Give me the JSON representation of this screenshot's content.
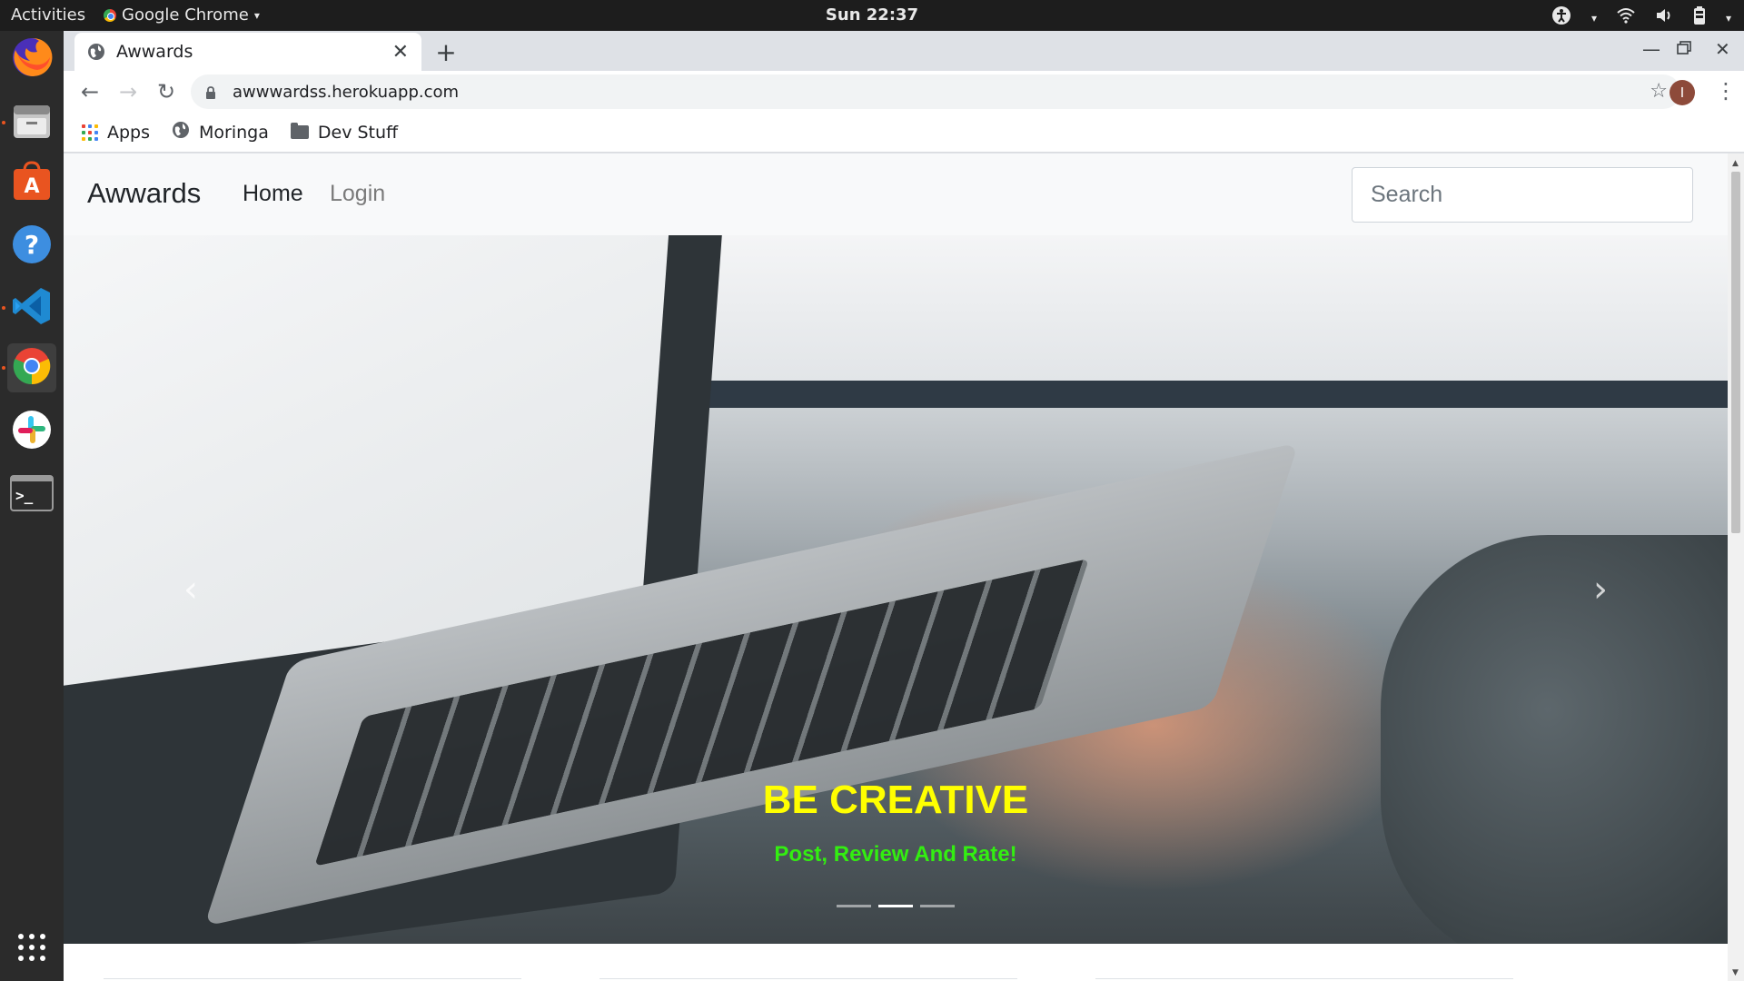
{
  "topbar": {
    "activities": "Activities",
    "app_name": "Google Chrome",
    "clock": "Sun 22:37"
  },
  "dock": {
    "apps": [
      "firefox-icon",
      "files-icon",
      "software-center-icon",
      "help-icon",
      "vscode-icon",
      "chrome-icon",
      "slack-icon",
      "terminal-icon",
      "show-apps-icon"
    ]
  },
  "browser": {
    "tab_title": "Awwards",
    "url": "awwwardss.herokuapp.com",
    "profile_initial": "I",
    "bookmarks": [
      "Apps",
      "Moringa",
      "Dev Stuff"
    ]
  },
  "site": {
    "brand": "Awwards",
    "nav": {
      "home": "Home",
      "login": "Login"
    },
    "search_placeholder": "Search",
    "carousel": {
      "title": "BE CREATIVE",
      "subtitle": "Post, Review And Rate!",
      "slides": 3,
      "active_slide": 2
    }
  },
  "colors": {
    "caption_title": "#ffff00",
    "caption_subtitle": "#33ee11",
    "navbar_bg": "#f8f9fa",
    "ubuntu_accent": "#e95420"
  }
}
